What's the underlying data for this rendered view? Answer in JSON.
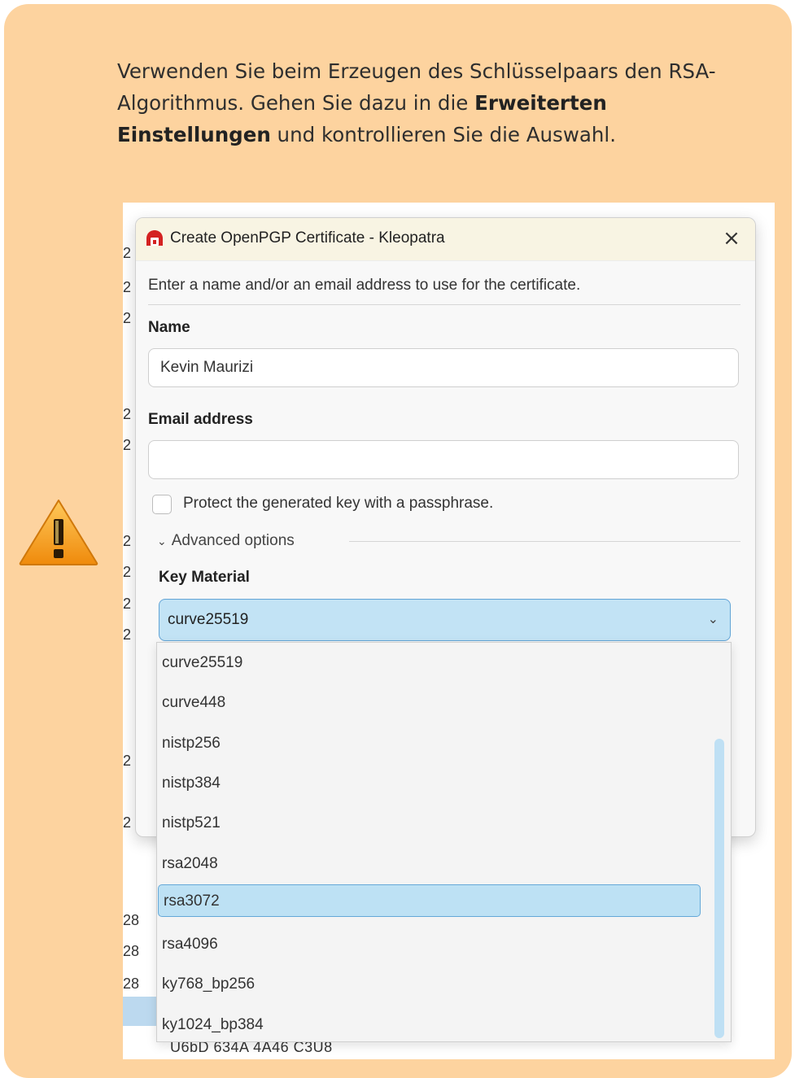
{
  "note": {
    "line1_a": "Verwenden Sie beim Erzeugen des Schlüsselpaars den RSA-",
    "line2_a": "Algorithmus. Gehen Sie dazu in die ",
    "line2_b": "Erweiterten",
    "line3_a": "Einstellungen",
    "line3_b": " und kontrollieren Sie die Auswahl.",
    "icon": "warning-icon",
    "colors": {
      "box": "#fdd39f",
      "warning": "#f29a12"
    }
  },
  "background": {
    "left_digits": [
      "2",
      "2",
      "2",
      "2",
      "2",
      "2",
      "2",
      "2",
      "2",
      "2",
      "2"
    ],
    "row_numbers": [
      "28",
      "28",
      "28"
    ],
    "hex_fragment": "U6bD 634A 4A46 C3U8"
  },
  "dialog": {
    "title": "Create OpenPGP Certificate - Kleopatra",
    "close": "×",
    "intro": "Enter a name and/or an email address to use for the certificate.",
    "name_label": "Name",
    "name_value": "Kevin Maurizi",
    "email_label": "Email address",
    "email_value": "",
    "passphrase_label": "Protect the generated key with a passphrase.",
    "passphrase_checked": false,
    "advanced_label": "Advanced options",
    "key_material_label": "Key Material",
    "key_material_value": "curve25519"
  },
  "dropdown": {
    "options": [
      "curve25519",
      "curve448",
      "nistp256",
      "nistp384",
      "nistp521",
      "rsa2048",
      "rsa3072",
      "rsa4096",
      "ky768_bp256",
      "ky1024_bp384"
    ],
    "highlighted": "rsa3072"
  }
}
